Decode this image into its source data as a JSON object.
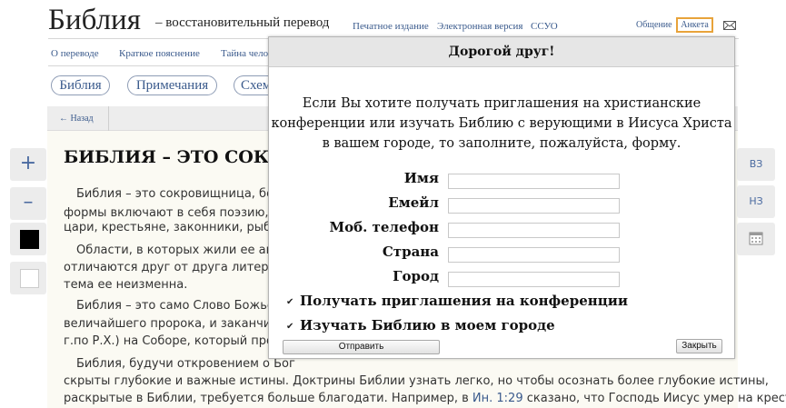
{
  "header": {
    "title": "Библия",
    "subtitle": "– восстановительный перевод",
    "links": [
      "Печатное издание",
      "Электронная версия",
      "ССУО"
    ],
    "right_link": "Общение",
    "anketa": "Анкета",
    "mail_icon": "mail-icon"
  },
  "nav": {
    "items": [
      "О переводе",
      "Краткое пояснение",
      "Тайна чело"
    ]
  },
  "pills": [
    "Библия",
    "Примечания",
    "Схем"
  ],
  "back": "← Назад",
  "article": {
    "heading": "БИБЛИЯ – ЭТО СОКР",
    "lines": [
      "Библия – это сокровищница, богат",
      "формы включают в себя поэзию, про",
      "цари, крестьяне, законники, рыбаки,",
      "Области, в которых жили ее автор",
      "отличаются друг от друга литератур",
      "тема ее неизменна.",
      "Библия – это само Слово Божье, вь",
      "величайшего пророка, и заканчивая",
      "г.по Р.Х.) на Соборе, который прошел",
      "Библия, будучи откровением о Бог",
      "скрыты глубокие и важные истины. Доктрины Библии узнать легко, но чтобы осознать более глубокие истины,",
      "раскрытые в Библии, требуется больше благодати. Например, в "
    ],
    "ref": "Ин. 1:29",
    "line_end": " сказано, что Господь Иисус умер на кресте,"
  },
  "tools": {
    "zoom_in": "+",
    "zoom_out": "–",
    "right": [
      "ВЗ",
      "НЗ"
    ],
    "calendar_icon": "calendar-icon"
  },
  "modal": {
    "title": "Дорогой друг!",
    "intro": [
      "Если Вы хотите получать приглашения на христианские",
      "конференции или изучать Библию с верующими в Иисуса Христа",
      "в вашем городе, то заполните, пожалуйста, форму."
    ],
    "fields": [
      {
        "label": "Имя",
        "value": ""
      },
      {
        "label": "Емейл",
        "value": ""
      },
      {
        "label": "Моб. телефон",
        "value": ""
      },
      {
        "label": "Страна",
        "value": ""
      },
      {
        "label": "Город",
        "value": ""
      }
    ],
    "checks": [
      {
        "label": "Получать приглашения на конференции",
        "checked": true
      },
      {
        "label": "Изучать Библию в моем городе",
        "checked": true
      }
    ],
    "submit": "Отправить",
    "close": "Закрыть"
  }
}
